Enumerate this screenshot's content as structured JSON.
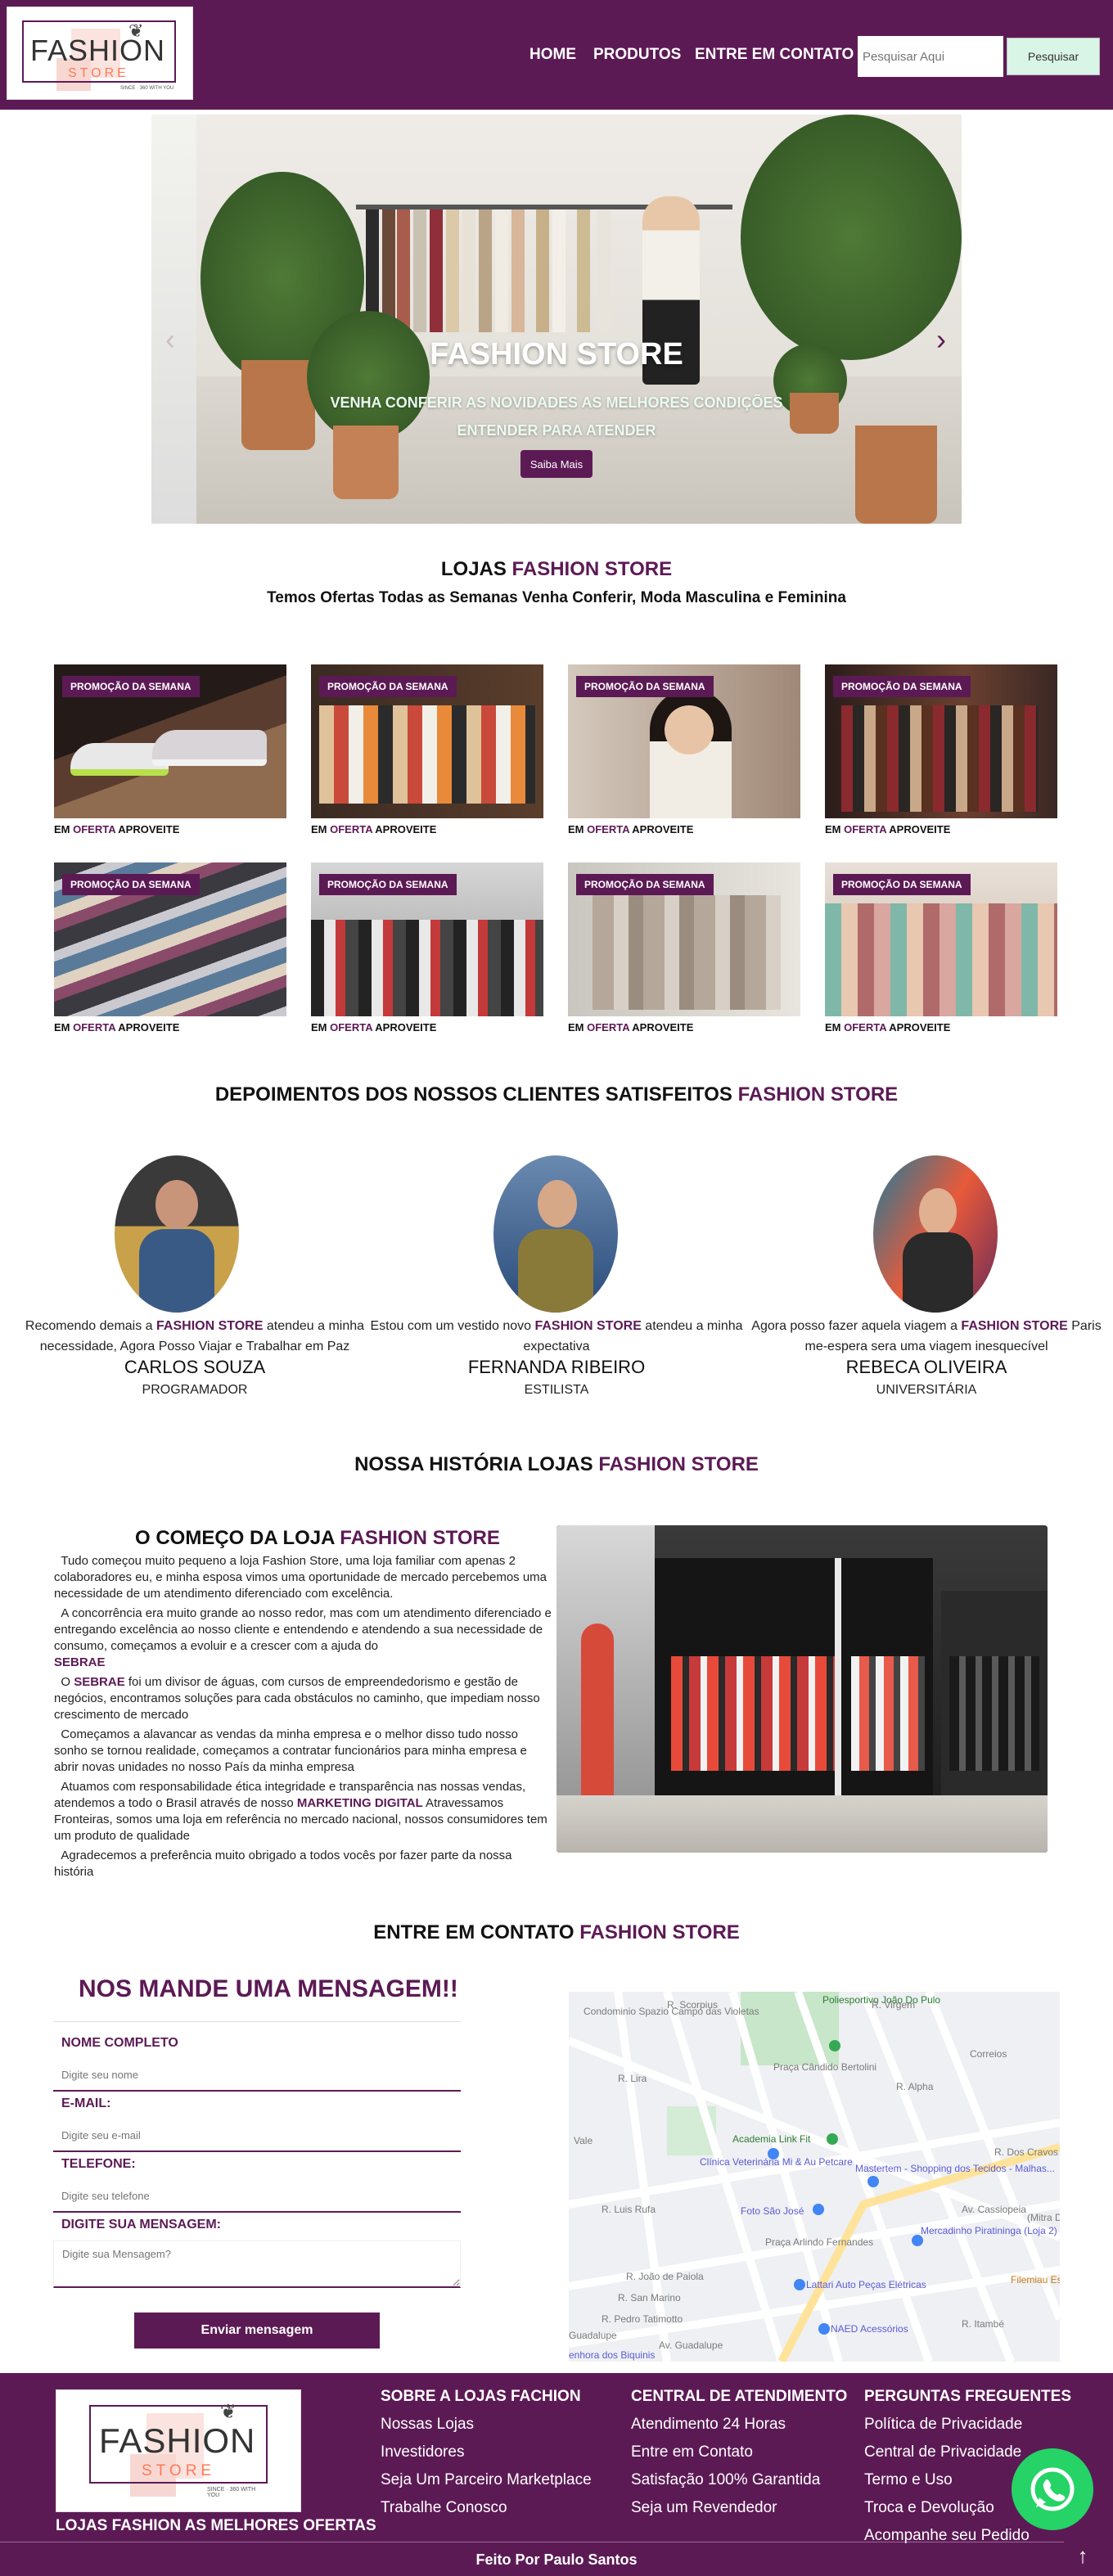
{
  "header": {
    "logo": {
      "word1": "FASHION",
      "word2": "STORE",
      "tagline": "SINCE · 360 WITH YOU"
    },
    "nav": [
      "HOME",
      "PRODUTOS",
      "ENTRE EM CONTATO"
    ],
    "search_placeholder": "Pesquisar Aqui",
    "search_button": "Pesquisar"
  },
  "hero": {
    "title": "FASHION STORE",
    "line1": "VENHA CONFERIR AS NOVIDADES AS MELHORES CONDIÇÕES",
    "line2": "ENTENDER PARA ATENDER",
    "button": "Saiba Mais"
  },
  "lojas": {
    "title_a": "LOJAS ",
    "title_b": "FASHION STORE",
    "subtitle": "Temos Ofertas Todas as Semanas Venha Conferir, Moda Masculina e Feminina"
  },
  "promos": {
    "badge": "PROMOÇÃO DA SEMANA",
    "cap_a": "EM ",
    "cap_b": "OFERTA",
    "cap_c": " APROVEITE"
  },
  "depoimentos": {
    "title_a": "DEPOIMENTOS DOS NOSSOS CLIENTES SATISFEITOS ",
    "title_b": "FASHION STORE",
    "items": [
      {
        "text_a": "Recomendo demais a ",
        "brand": "FASHION STORE",
        "text_b": " atendeu a minha necessidade, Agora Posso Viajar e Trabalhar em Paz",
        "name": "CARLOS SOUZA",
        "role": "PROGRAMADOR"
      },
      {
        "text_a": "Estou com um vestido novo ",
        "brand": "FASHION STORE",
        "text_b": " atendeu a minha expectativa",
        "name": "FERNANDA RIBEIRO",
        "role": "ESTILISTA"
      },
      {
        "text_a": "Agora posso fazer aquela viagem a ",
        "brand": "FASHION STORE",
        "text_b": " Paris me-espera sera uma viagem inesquecível",
        "name": "REBECA OLIVEIRA",
        "role": "UNIVERSITÁRIA"
      }
    ]
  },
  "historia": {
    "title_a": "NOSSA HISTÓRIA LOJAS ",
    "title_b": "FASHION STORE",
    "sub_a": "O COMEÇO DA LOJA ",
    "sub_b": "FASHION STORE",
    "p1": "Tudo começou muito pequeno a loja Fashion Store, uma loja familiar com apenas 2 colaboradores eu, e minha esposa vimos uma oportunidade de mercado percebemos uma necessidade de um atendimento diferenciado com excelência.",
    "p2": "A concorrência era muito grande ao nosso redor, mas com um atendimento diferenciado e entregando excelência ao nosso cliente e entendendo e atendendo a sua necessidade de consumo, começamos a evoluir e a crescer com a ajuda do",
    "p2_brand": "SEBRAE",
    "p3_pre": "O ",
    "p3_brand": "SEBRAE",
    "p3": " foi um divisor de águas, com cursos de empreendedorismo e gestão de negócios, encontramos soluções para cada obstáculos no caminho, que impediam nosso crescimento de mercado",
    "p4": "Começamos a alavancar as vendas da minha empresa e o melhor disso tudo nosso sonho se tornou realidade, começamos a contratar funcionários para minha empresa e abrir novas unidades no nosso País da minha empresa",
    "p5_a": "Atuamos com responsabilidade ética integridade e transparência nas nossas vendas, atendemos a todo o Brasil através de nosso ",
    "p5_brand": "MARKETING DIGITAL",
    "p5_b": " Atravessamos Fronteiras, somos uma loja em referência no mercado nacional, nossos consumidores tem um produto de qualidade",
    "p6": "Agradecemos a preferência muito obrigado a todos vocês por fazer parte da nossa história"
  },
  "contato": {
    "title_a": "ENTRE EM CONTATO ",
    "title_b": "FASHION STORE",
    "form_title": "NOS MANDE UMA MENSAGEM!!",
    "fields": [
      {
        "label": "NOME COMPLETO",
        "placeholder": "Digite seu nome"
      },
      {
        "label": "E-MAIL:",
        "placeholder": "Digite seu e-mail"
      },
      {
        "label": "TELEFONE:",
        "placeholder": "Digite seu telefone"
      },
      {
        "label": "DIGITE SUA MENSAGEM:",
        "placeholder": "Digite sua Mensagem?"
      }
    ],
    "submit": "Enviar mensagem",
    "map_labels": [
      "Condominio Spazio Campo das Violetas",
      "Poliesportivo João Do Pulo",
      "Praça Cândido Bertolini",
      "Correios",
      "Academia Link Fit",
      "Clínica Veterinária Mi & Au Petcare",
      "Foto São José",
      "Mastertem - Shopping dos Tecidos - Malhas...",
      "Praça Arlindo Fernandes",
      "Mercadinho Piratininga (Loja 2)",
      "Lattari Auto Peças Elétricas",
      "NAED Acessórios",
      "Filemiau Espetinho Sertanejo",
      "Vale",
      "Av. Guadalupe",
      "Guadalupe",
      "Av. Cassiopeia",
      "R. João de Paiola",
      "R. San Marino",
      "R. Pedro Tatimotto",
      "R. Itambé",
      "R. Scorpius",
      "R. Lira",
      "R. Virgem",
      "R. Alpha",
      "R. Dos Cravos",
      "R. Luis Rufa",
      "(Mitra D",
      "enhora dos Biquinis"
    ]
  },
  "footer": {
    "logo_caption": "LOJAS FASHION AS MELHORES OFERTAS",
    "col1": {
      "head": "SOBRE A LOJAS FACHION",
      "links": [
        "Nossas Lojas",
        "Investidores",
        "Seja Um Parceiro Marketplace",
        "Trabalhe Conosco"
      ]
    },
    "col2": {
      "head": "CENTRAL DE ATENDIMENTO",
      "links": [
        "Atendimento 24 Horas",
        "Entre em Contato",
        "Satisfação 100% Garantida",
        "Seja um Revendedor"
      ]
    },
    "col3": {
      "head": "PERGUNTAS FREGUENTES",
      "links": [
        "Política de Privacidade",
        "Central de Privacidade",
        "Termo e Uso",
        "Troca e Devolução",
        "Acompanhe seu Pedido"
      ]
    },
    "credit": "Feito Por Paulo Santos"
  },
  "colors": {
    "brand": "#5c1a55",
    "whatsapp": "#25d366"
  },
  "icons": [
    "whatsapp-icon",
    "arrow-up-icon",
    "chevron-left-icon",
    "chevron-right-icon",
    "map-pin-icon"
  ]
}
